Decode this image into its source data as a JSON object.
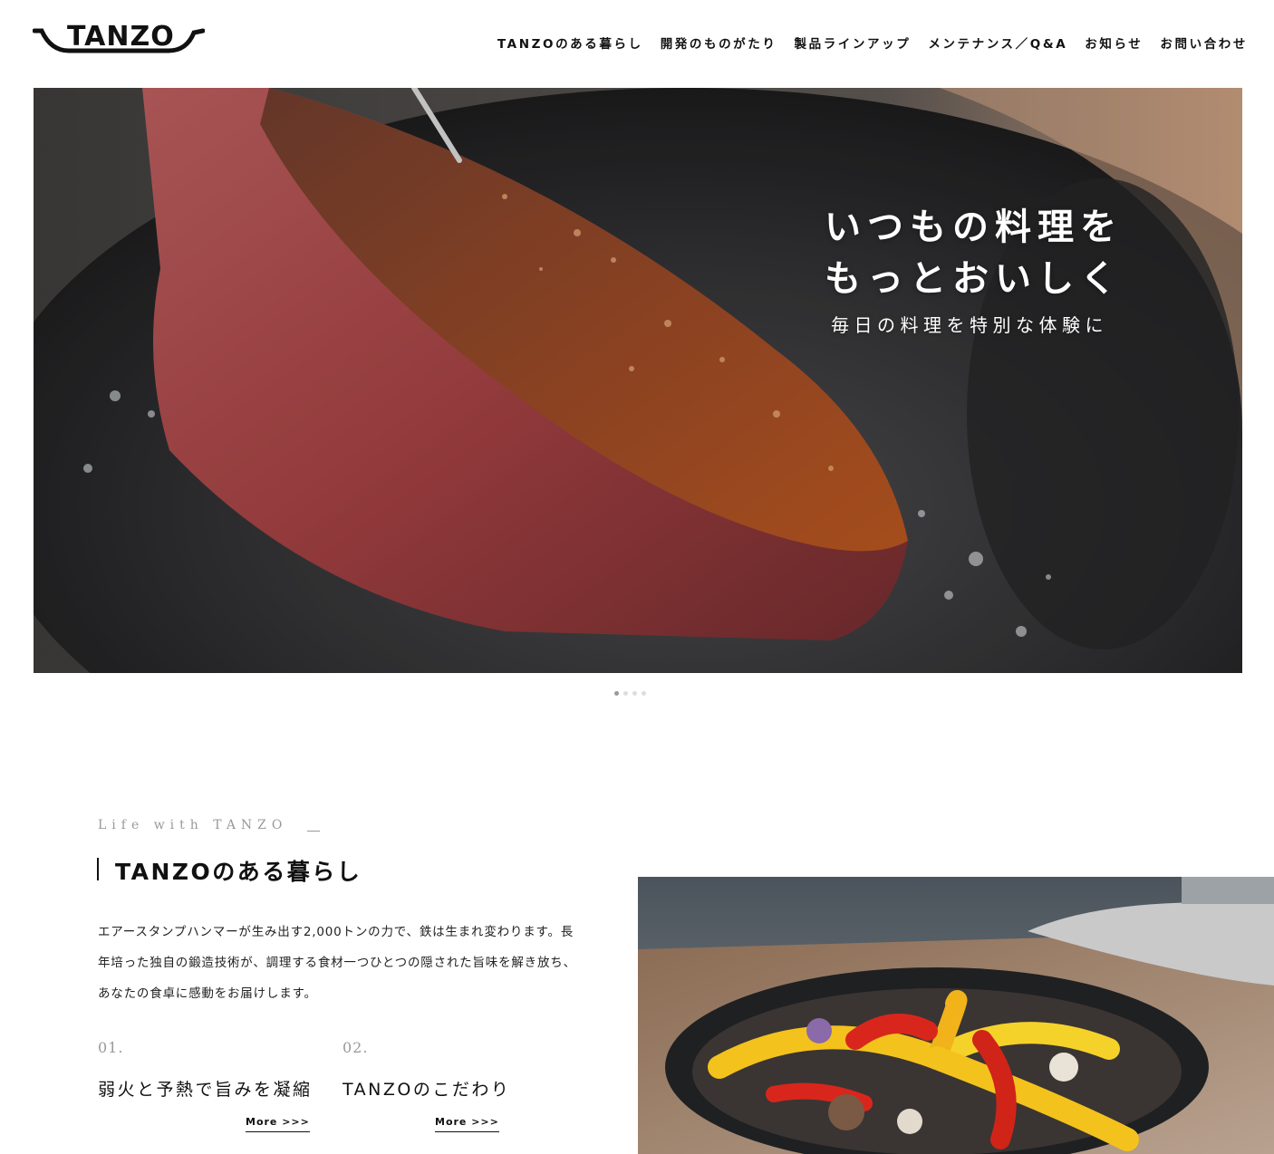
{
  "header": {
    "logo_text": "TANZO",
    "nav": [
      "TANZOのある暮らし",
      "開発のものがたり",
      "製品ラインアップ",
      "メンテナンス／Q&A",
      "お知らせ",
      "お問い合わせ"
    ]
  },
  "hero": {
    "title_line1": "いつもの料理を",
    "title_line2": "もっとおいしく",
    "subtitle": "毎日の料理を特別な体験に",
    "slide_count": 4,
    "active_slide": 1
  },
  "section": {
    "eyebrow": "Life with TANZO",
    "title": "TANZOのある暮らし",
    "body": "エアースタンプハンマーが生み出す2,000トンの力で、鉄は生まれ変わります。長年培った独自の鍛造技術が、調理する食材一つひとつの隠された旨味を解き放ち、あなたの食卓に感動をお届けします。",
    "features": [
      {
        "num": "01.",
        "title": "弱火と予熱で旨みを凝縮",
        "more": "More >>>"
      },
      {
        "num": "02.",
        "title": "TANZOのこだわり",
        "more": "More >>>"
      }
    ]
  },
  "colors": {
    "text": "#111111",
    "muted": "#999999",
    "pan": "#2a2a2c",
    "meat_crust": "#8a3a22"
  }
}
